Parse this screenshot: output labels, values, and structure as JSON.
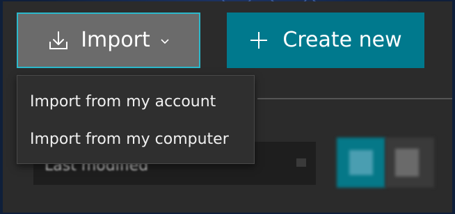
{
  "toolbar": {
    "import_label": "Import",
    "create_label": "Create new"
  },
  "import_menu": {
    "items": [
      {
        "label": "Import from my account"
      },
      {
        "label": "Import from my computer"
      }
    ]
  },
  "sort": {
    "selected": "Last modified"
  },
  "view_toggle": {
    "options": [
      "grid-view-icon",
      "list-view-icon"
    ],
    "selected": "grid-view-icon"
  },
  "colors": {
    "accent": "#00798d",
    "focus_border": "#2bb9cc",
    "panel": "#2b2b2b",
    "import_button": "#6b6b6b"
  },
  "icons": {
    "import": "download-tray-icon",
    "import_chevron": "chevron-down-icon",
    "create": "plus-icon"
  }
}
